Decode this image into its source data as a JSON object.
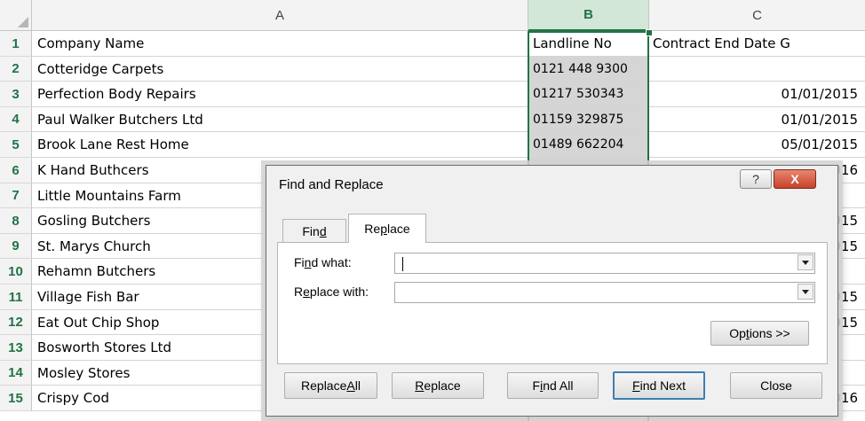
{
  "columns": {
    "a": "A",
    "b": "B",
    "c": "C"
  },
  "rows": [
    {
      "num": "1",
      "a": "Company Name",
      "b": "Landline No",
      "c": "Contract End Date G"
    },
    {
      "num": "2",
      "a": "Cotteridge Carpets",
      "b": "0121 448 9300",
      "c": ""
    },
    {
      "num": "3",
      "a": "Perfection Body Repairs",
      "b": "01217 530343",
      "c": "01/01/2015"
    },
    {
      "num": "4",
      "a": "Paul Walker Butchers Ltd",
      "b": "01159 329875",
      "c": "01/01/2015"
    },
    {
      "num": "5",
      "a": "Brook Lane Rest Home",
      "b": "01489 662204",
      "c": "05/01/2015"
    },
    {
      "num": "6",
      "a": "K Hand Buthcers",
      "b": "",
      "c": "016"
    },
    {
      "num": "7",
      "a": "Little Mountains Farm",
      "b": "",
      "c": ""
    },
    {
      "num": "8",
      "a": "Gosling Butchers",
      "b": "",
      "c": "015"
    },
    {
      "num": "9",
      "a": "St. Marys Church",
      "b": "",
      "c": "015"
    },
    {
      "num": "10",
      "a": "Rehamn Butchers",
      "b": "",
      "c": ""
    },
    {
      "num": "11",
      "a": "Village Fish Bar",
      "b": "",
      "c": "015"
    },
    {
      "num": "12",
      "a": "Eat Out Chip Shop",
      "b": "",
      "c": "015"
    },
    {
      "num": "13",
      "a": "Bosworth Stores Ltd",
      "b": "",
      "c": ""
    },
    {
      "num": "14",
      "a": "Mosley Stores",
      "b": "",
      "c": ""
    },
    {
      "num": "15",
      "a": "Crispy Cod",
      "b": "",
      "c": "016"
    }
  ],
  "dialog": {
    "title": "Find and Replace",
    "help_label": "?",
    "close_label": "X",
    "tabs": {
      "find": {
        "pre": "Fin",
        "key": "d",
        "post": ""
      },
      "replace": {
        "pre": "Re",
        "key": "p",
        "post": "lace"
      }
    },
    "find_what": {
      "pre": "Fi",
      "key": "n",
      "post": "d what:",
      "value": ""
    },
    "replace_with": {
      "pre": "R",
      "key": "e",
      "post": "place with:",
      "value": ""
    },
    "options": {
      "pre": "Op",
      "key": "t",
      "post": "ions >>"
    },
    "buttons": {
      "replace_all": {
        "pre": "Replace ",
        "key": "A",
        "post": "ll"
      },
      "replace": {
        "pre": "",
        "key": "R",
        "post": "eplace"
      },
      "find_all": {
        "pre": "F",
        "key": "i",
        "post": "nd All"
      },
      "find_next": {
        "pre": "",
        "key": "F",
        "post": "ind Next"
      },
      "close": {
        "pre": "Close",
        "key": "",
        "post": ""
      }
    }
  },
  "colors": {
    "selection_green": "#217346",
    "selected_column_fill": "#d5d5d5"
  }
}
